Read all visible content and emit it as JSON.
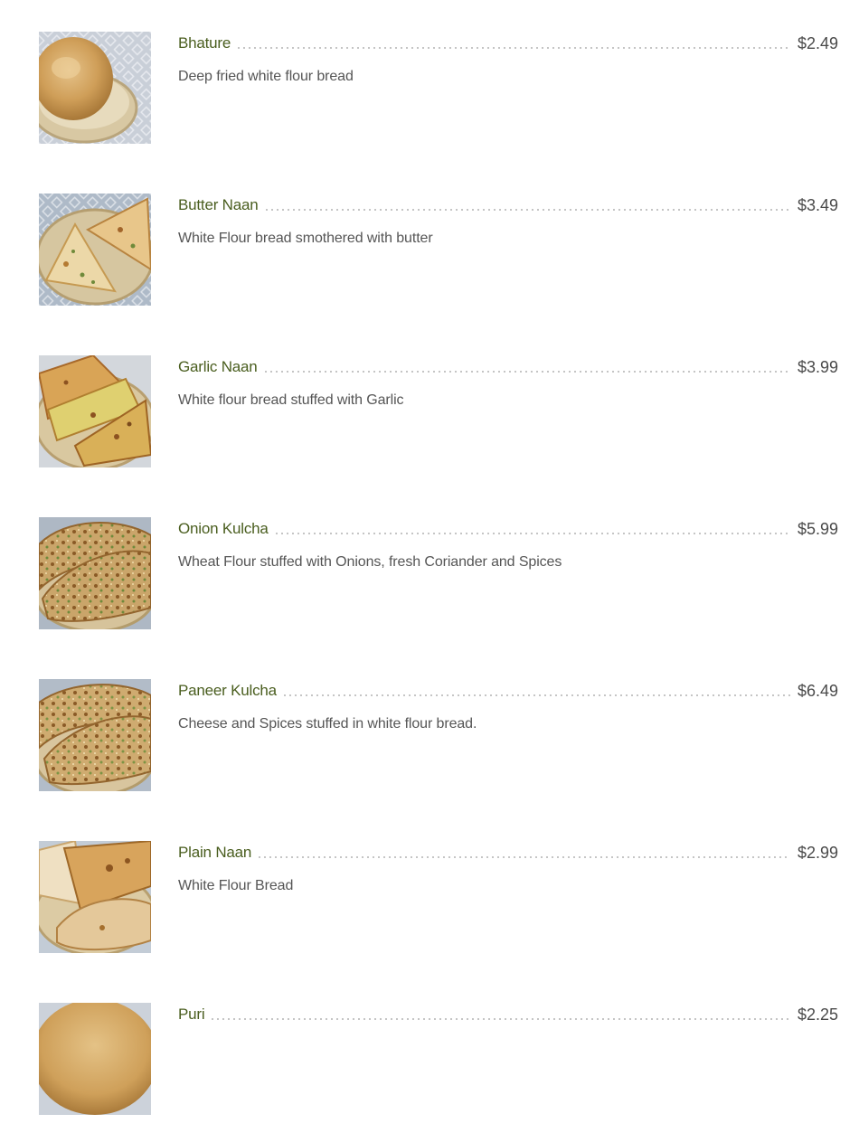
{
  "menu": {
    "items": [
      {
        "name": "Bhature",
        "price": "$2.49",
        "description": "Deep fried white flour bread",
        "image_icon": "bhature-photo"
      },
      {
        "name": "Butter Naan",
        "price": "$3.49",
        "description": "White Flour bread smothered with butter",
        "image_icon": "butter-naan-photo"
      },
      {
        "name": "Garlic Naan",
        "price": "$3.99",
        "description": "White flour bread stuffed with Garlic",
        "image_icon": "garlic-naan-photo"
      },
      {
        "name": "Onion Kulcha",
        "price": "$5.99",
        "description": "Wheat Flour stuffed with Onions, fresh Coriander and Spices",
        "image_icon": "onion-kulcha-photo"
      },
      {
        "name": "Paneer Kulcha",
        "price": "$6.49",
        "description": "Cheese and Spices stuffed in white flour bread.",
        "image_icon": "paneer-kulcha-photo"
      },
      {
        "name": "Plain Naan",
        "price": "$2.99",
        "description": "White Flour Bread",
        "image_icon": "plain-naan-photo"
      },
      {
        "name": "Puri",
        "price": "$2.25",
        "description": "",
        "image_icon": "puri-photo"
      }
    ]
  },
  "colors": {
    "name": "#4a5e1f",
    "price": "#4a4a4a",
    "description": "#555555",
    "dots": "#b6b6b6"
  }
}
